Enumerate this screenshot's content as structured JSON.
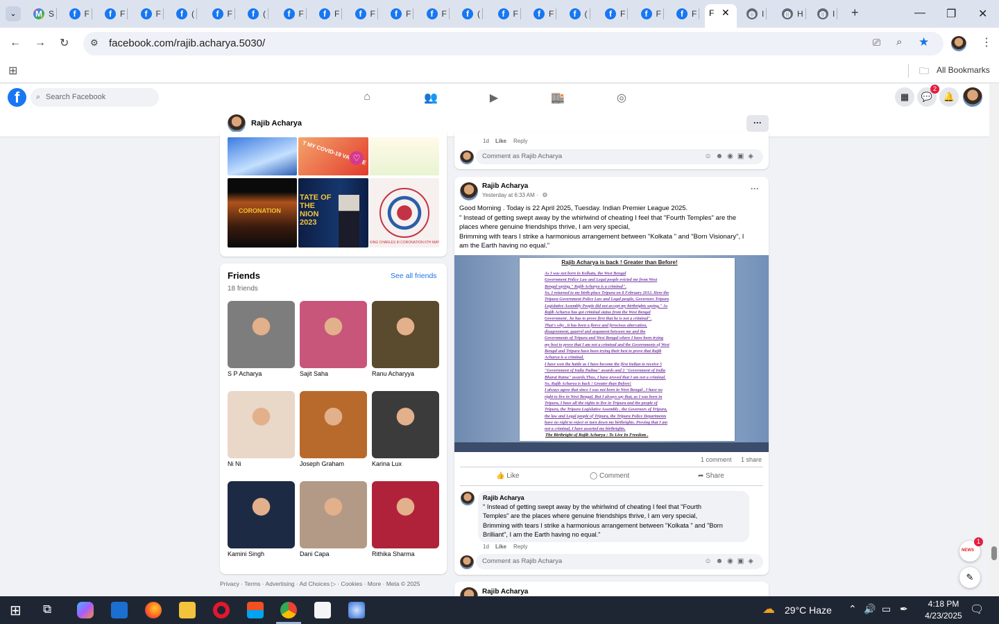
{
  "browser": {
    "tabs": [
      {
        "label": "S",
        "icon": "gmail-icon"
      },
      {
        "label": "F",
        "icon": "facebook-icon"
      },
      {
        "label": "F",
        "icon": "facebook-icon"
      },
      {
        "label": "F",
        "icon": "facebook-icon"
      },
      {
        "label": "(",
        "icon": "facebook-icon"
      },
      {
        "label": "F",
        "icon": "facebook-icon"
      },
      {
        "label": "(",
        "icon": "facebook-icon"
      },
      {
        "label": "F",
        "icon": "facebook-icon"
      },
      {
        "label": "F",
        "icon": "facebook-icon"
      },
      {
        "label": "F",
        "icon": "facebook-icon"
      },
      {
        "label": "F",
        "icon": "facebook-icon"
      },
      {
        "label": "F",
        "icon": "facebook-icon"
      },
      {
        "label": "(",
        "icon": "facebook-icon"
      },
      {
        "label": "F",
        "icon": "facebook-icon"
      },
      {
        "label": "F",
        "icon": "facebook-icon"
      },
      {
        "label": "(",
        "icon": "facebook-icon"
      },
      {
        "label": "F",
        "icon": "facebook-icon"
      },
      {
        "label": "F",
        "icon": "facebook-icon"
      },
      {
        "label": "F",
        "icon": "facebook-icon"
      },
      {
        "label": "F",
        "icon": "facebook-icon"
      },
      {
        "label": "I",
        "icon": "globe-icon"
      },
      {
        "label": "H",
        "icon": "globe-icon"
      },
      {
        "label": "I",
        "icon": "globe-icon"
      }
    ],
    "url": "facebook.com/rajib.acharya.5030/",
    "all_bookmarks": "All Bookmarks"
  },
  "facebook": {
    "search_placeholder": "Search Facebook",
    "messenger_badge": "2",
    "profile_name": "Rajib Acharya",
    "more_button": "···"
  },
  "photos": {
    "tiles": [
      {
        "caption": ""
      },
      {
        "caption": "T MY COVID-19 VACCINE"
      },
      {
        "caption": ""
      },
      {
        "caption": "CORONATION"
      },
      {
        "caption": "TATE OF THE NION 2023"
      },
      {
        "caption": "KING CHARLES III CORONATION 6TH MAY 2023"
      }
    ]
  },
  "friends": {
    "title": "Friends",
    "see_all": "See all friends",
    "count": "18 friends",
    "list": [
      {
        "name": "S P Acharya",
        "color": "#7d7d7d"
      },
      {
        "name": "Sajit Saha",
        "color": "#c8557a"
      },
      {
        "name": "Ranu Acharyya",
        "color": "#5a4a2e"
      },
      {
        "name": "Ni Ni",
        "color": "#e9d7c8"
      },
      {
        "name": "Joseph Graham",
        "color": "#b86a2c"
      },
      {
        "name": "Karina Lux",
        "color": "#3b3b3b"
      },
      {
        "name": "Kamini Singh",
        "color": "#1d2a44"
      },
      {
        "name": "Dani Capa",
        "color": "#b39a86"
      },
      {
        "name": "Rithika Sharma",
        "color": "#b0223a"
      }
    ]
  },
  "footer_links": "Privacy · Terms · Advertising · Ad Choices ▷ · Cookies · More · Meta © 2025",
  "feed": {
    "top_comment_meta": {
      "time": "1d",
      "like": "Like",
      "reply": "Reply"
    },
    "comment_placeholder": "Comment as Rajib Acharya",
    "post": {
      "author": "Rajib Acharya",
      "time": "Yesterday at 6:33 AM ·",
      "lines": [
        "Good Morning . Today is 22 April 2025, Tuesday. Indian Premier League 2025.",
        "\" Instead of getting swept away by the whirlwind of cheating I feel that \"Fourth Temples\" are the",
        "places where genuine friendships thrive, I am very special,",
        "Brimming with tears I strike a harmonious arrangement between \"Kolkata \" and \"Born Visionary\", I",
        "am the Earth having no equal.\""
      ],
      "doc_title": "Rajib Acharya is back ! Greater than Before!",
      "doc_lines": [
        "As I was not born in Kolkata, the West Bengal",
        "Government Police Law and Legal people evicted me from West",
        "Bengal saying,\" Rajib Acharya is a criminal\".",
        "So, I returned to my birth-place Tripura on 8 February 2012. Here the",
        "Tripura Government Police Law and Legal people, Governors Tripura",
        "Legislative Assembly People did not accept my birthrights saying,\" As",
        "Rajib Acharya has got criminal status from the West Bengal",
        "Government , he has to prove first that he is not a criminal\".",
        "That's why , it has been a fierce and ferocious altercation,",
        "disagreement, quarrel and argument between me and the",
        "Governments of Tripura and West Bengal where I have been trying",
        "my best to prove that I am not a criminal and the Governments of West",
        "Bengal and Tripura have been trying their best to prove that Rajib",
        "Acharya is a criminal.",
        "I have won the battle as I have become the first Indian to receive 5",
        "\"Government of India Padma\" awards and 2 \"Government of India",
        "Bharat Ratna\" awards.Thus, I have proved that I am not a criminal.",
        "So, Rajib Acharya is back ! Greater than Before!",
        "I always agree that since I was not born in West Bengal , I have no",
        "right to live in West Bengal. But I always say that, as I was born in",
        "Tripura, I have all the rights to live in Tripura and the people of",
        "Tripura, the Tripura Legislative Assembly , the Governors of Tripura,",
        "the law and Legal people of Tripura, the Tripura Police Departments",
        "have no right to reject or turn down my birthrights. Proving that I am",
        "not a criminal, I have asserted my birthrights."
      ],
      "doc_footer": "The Birthright of Rajib Acharya : To Live In Freedom .",
      "stats": {
        "comments": "1 comment",
        "shares": "1 share"
      },
      "actions": {
        "like": "Like",
        "comment": "Comment",
        "share": "Share"
      }
    },
    "comment": {
      "author": "Rajib Acharya",
      "lines": [
        "\" Instead of getting swept away by the whirlwind of cheating I feel that \"Fourth",
        "Temples\" are the places where genuine friendships thrive, I am very special,",
        "Brimming with tears I strike a harmonious arrangement between \"Kolkata \" and \"Born",
        "Brilliant\", I am the Earth having no equal.\""
      ],
      "time": "1d",
      "like": "Like",
      "reply": "Reply"
    },
    "next_post_author": "Rajib Acharya",
    "news_badge": "1",
    "news_label": "NEWS"
  },
  "taskbar": {
    "weather": "29°C  Haze",
    "time": "4:18 PM",
    "date": "4/23/2025"
  }
}
